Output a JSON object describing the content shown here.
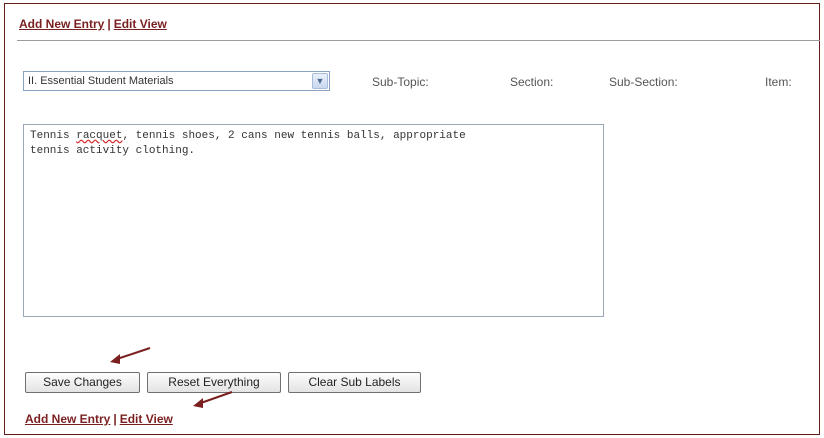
{
  "nav_top": {
    "add_new_entry": "Add New Entry",
    "separator": "|",
    "edit_view": "Edit View"
  },
  "topic_select": {
    "value": "II. Essential Student Materials"
  },
  "labels": {
    "sub_topic": "Sub-Topic:",
    "section": "Section:",
    "sub_section": "Sub-Section:",
    "item": "Item:"
  },
  "editor": {
    "line1_before": "Tennis ",
    "line1_misspelled": "racquet",
    "line1_after": ", tennis shoes, 2 cans new tennis balls, appropriate",
    "line2": "tennis activity clothing."
  },
  "buttons": {
    "save": "Save Changes",
    "reset": "Reset Everything",
    "clear": "Clear Sub Labels"
  },
  "nav_bottom": {
    "add_new_entry": "Add New Entry",
    "separator": "|",
    "edit_view": "Edit View"
  },
  "colors": {
    "link": "#7a1f1f",
    "annotation_arrow": "#7a1f1f",
    "frame": "#6b1a1a"
  },
  "icons": {
    "select_arrow": "chevron-down-icon",
    "annotation": "arrow-annotation-icon"
  }
}
